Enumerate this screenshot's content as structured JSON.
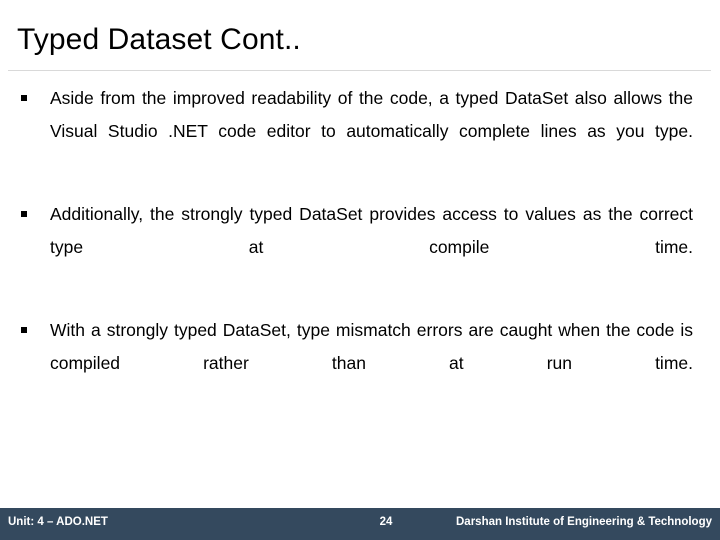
{
  "slide": {
    "title": "Typed Dataset Cont..",
    "bullets": [
      {
        "marker": "square-bullet",
        "text": "Aside from the improved readability of the code, a typed DataSet also allows the Visual Studio .NET code editor to automatically complete lines as you type."
      },
      {
        "marker": "square-bullet",
        "text": "Additionally, the strongly typed DataSet provides access to values as the correct type at compile time."
      },
      {
        "marker": "square-bullet",
        "text": "With a strongly typed DataSet, type mismatch errors are caught when the code is compiled rather than at run time."
      }
    ],
    "footer": {
      "unit": "Unit: 4 – ADO.NET",
      "page_number": "24",
      "organization": "Darshan Institute of Engineering & Technology",
      "bar_color": "#34495E",
      "text_color": "#FFFFFF"
    },
    "divider_color": "#D9D9D9",
    "background_color": "#FFFFFF",
    "text_color": "#000000"
  }
}
